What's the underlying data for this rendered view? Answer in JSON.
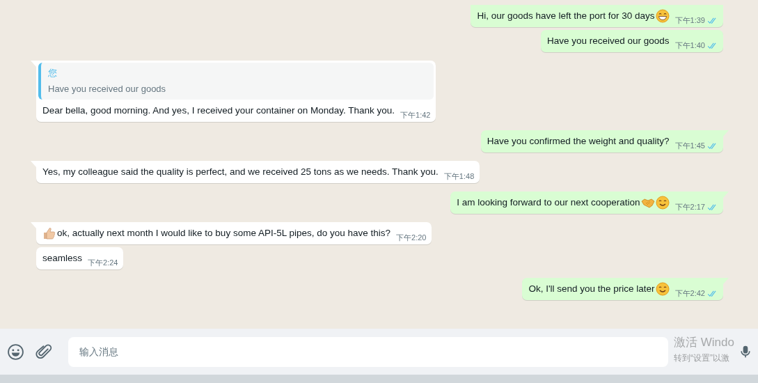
{
  "messages": [
    {
      "kind": "outgoing",
      "text": "Hi, our goods have left the port for 30 days",
      "trail_icons": [
        {
          "kind": "grin"
        }
      ],
      "time": "下午1:39",
      "read": true
    },
    {
      "kind": "outgoing",
      "text": "Have you received our goods",
      "time": "下午1:40",
      "read": true
    },
    {
      "kind": "incoming",
      "quote": {
        "author": "您",
        "text": "Have you received our goods"
      },
      "text": "Dear bella, good morning. And yes, I received your container on Monday. Thank you.",
      "time": "下午1:42"
    },
    {
      "kind": "outgoing",
      "text": "Have you confirmed the weight and quality?",
      "time": "下午1:45",
      "read": true
    },
    {
      "kind": "incoming",
      "text": "Yes, my colleague said the quality is perfect, and we received 25 tons as we needs. Thank you.",
      "time": "下午1:48"
    },
    {
      "kind": "outgoing",
      "text": "I am looking forward to our next cooperation",
      "trail_icons": [
        {
          "kind": "handshake"
        },
        {
          "kind": "smile"
        }
      ],
      "time": "下午2:17",
      "read": true
    },
    {
      "kind": "incoming",
      "lead_icons": [
        {
          "kind": "thumbs-up"
        }
      ],
      "text": "ok, actually next month I would like to buy some API-5L pipes, do you have this?",
      "time": "下午2:20"
    },
    {
      "kind": "incoming",
      "text": "seamless",
      "time": "下午2:24"
    },
    {
      "kind": "outgoing",
      "text": "Ok, I'll send you the price later",
      "trail_icons": [
        {
          "kind": "smile"
        }
      ],
      "time": "下午2:42",
      "read": true
    }
  ],
  "composer": {
    "placeholder": "输入消息"
  },
  "os_overlay": {
    "title": "激活 Windo",
    "hint": "转到“设置”以激"
  }
}
